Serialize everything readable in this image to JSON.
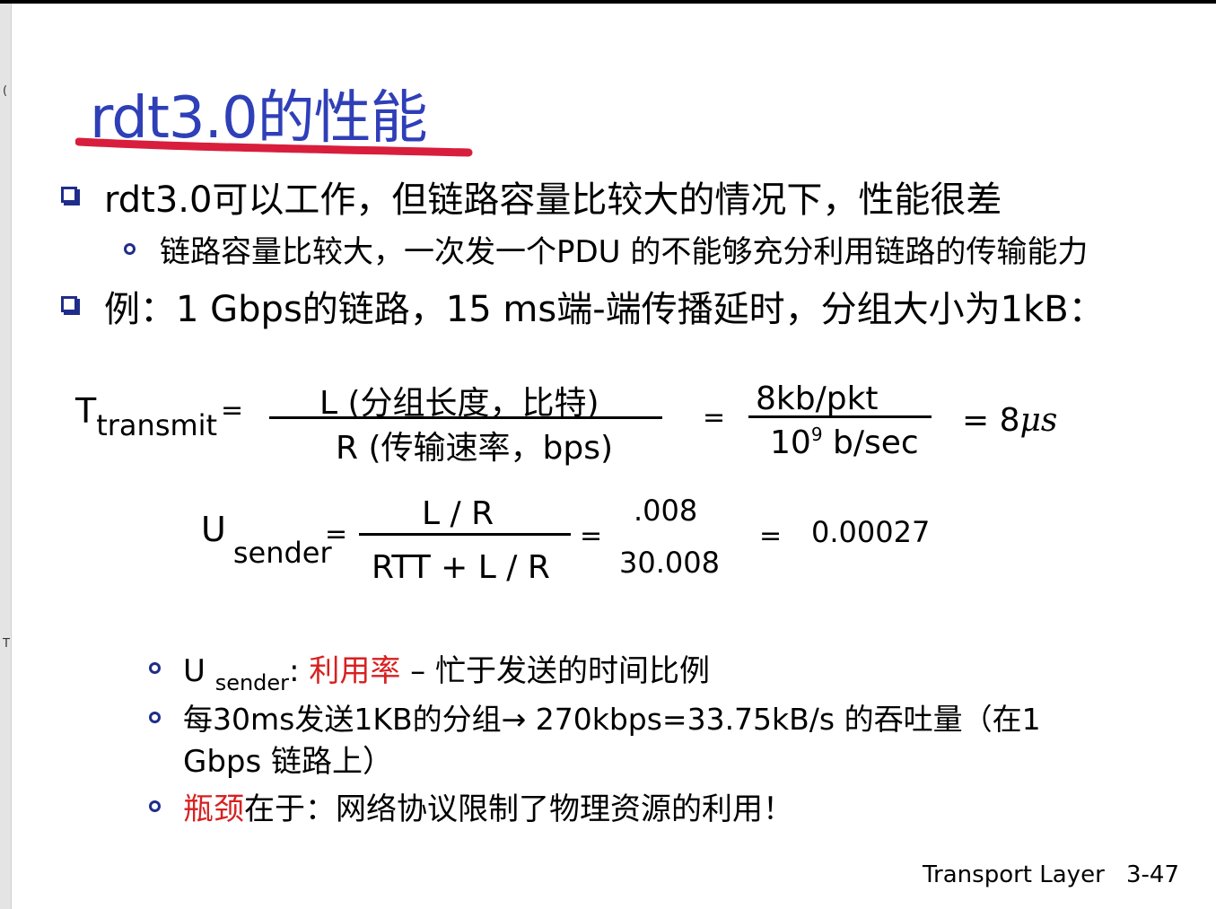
{
  "title": "rdt3.0的性能",
  "bullets": [
    {
      "text": "rdt3.0可以工作，但链路容量比较大的情况下，性能很差"
    },
    {
      "text": "链路容量比较大，一次发一个PDU 的不能够充分利用链路的传输能力"
    },
    {
      "text": "例：1 Gbps的链路，15 ms端-端传播延时，分组大小为1kB："
    }
  ],
  "formula1": {
    "lhs_main": "T",
    "lhs_sub": "transmit",
    "eq": "=",
    "num": "L (分组长度，比特)",
    "den": "R (传输速率，bps)",
    "eq2": "=",
    "num2": "8kb/pkt",
    "den2_base": "10",
    "den2_exp": "9",
    "den2_rest": " b/sec",
    "result": "= 8",
    "result_unit": "μs"
  },
  "formula2": {
    "lhs_main": "U",
    "lhs_sub": "sender",
    "eq": "=",
    "num": "L / R",
    "den": "RTT + L / R",
    "eq2": "=",
    "num2": ".008",
    "den2": "30.008",
    "eq3": "=",
    "result": "0.00027"
  },
  "sub_bullets": [
    {
      "prefix": "U ",
      "sub": "sender",
      "colon": ": ",
      "red": "利用率",
      "rest": " – 忙于发送的时间比例"
    },
    {
      "line1": "每30ms发送1KB的分组→ 270kbps=33.75kB/s 的吞吐量（在1",
      "line2": "Gbps 链路上）"
    },
    {
      "red": "瓶颈",
      "rest": "在于：网络协议限制了物理资源的利用！"
    }
  ],
  "footer": {
    "label": "Transport Layer",
    "page": "3-47"
  },
  "gutter": {
    "mark1": "(",
    "mark2": "T"
  },
  "colors": {
    "title": "#2f3fb8",
    "accent": "#d82020",
    "underline": "#d81e3c",
    "bullet": "#1f2d8a"
  }
}
